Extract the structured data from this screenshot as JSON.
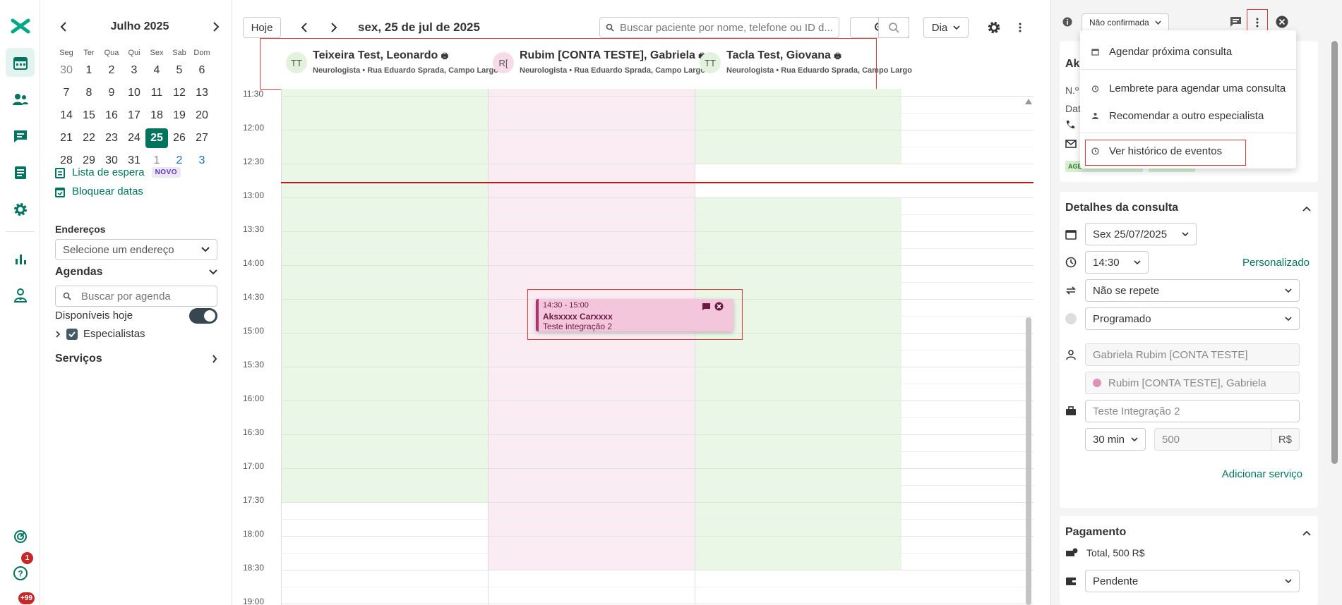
{
  "sidebar": {
    "badges": {
      "help": "1",
      "notifications": "+99"
    }
  },
  "mini_calendar": {
    "month_label": "Julho 2025",
    "weekdays": [
      "Seg",
      "Ter",
      "Qua",
      "Qui",
      "Sex",
      "Sab",
      "Dom"
    ],
    "weeks": [
      [
        "30",
        "1",
        "2",
        "3",
        "4",
        "5",
        "6"
      ],
      [
        "7",
        "8",
        "9",
        "10",
        "11",
        "12",
        "13"
      ],
      [
        "14",
        "15",
        "16",
        "17",
        "18",
        "19",
        "20"
      ],
      [
        "21",
        "22",
        "23",
        "24",
        "25",
        "26",
        "27"
      ],
      [
        "28",
        "29",
        "30",
        "31",
        "1",
        "2",
        "3"
      ]
    ],
    "selected_day": "25"
  },
  "left_panel": {
    "waitlist_label": "Lista de espera",
    "novo_badge": "NOVO",
    "block_dates_label": "Bloquear datas",
    "addresses_label": "Endereços",
    "address_placeholder": "Selecione um endereço",
    "agendas_label": "Agendas",
    "agenda_search_placeholder": "Buscar por agenda",
    "available_today_label": "Disponíveis hoje",
    "specialists_label": "Especialistas",
    "services_label": "Serviços"
  },
  "toolbar": {
    "today_label": "Hoje",
    "date_label": "sex, 25 de jul de 2025",
    "search_placeholder": "Buscar paciente por nome, telefone ou ID d...",
    "view_label": "Dia"
  },
  "resources": [
    {
      "initials": "TT",
      "name": "Teixeira Test, Leonardo",
      "subtitle": "Neurologista • Rua Eduardo Sprada, Campo Largo",
      "avatar_color": "#e3f2dc"
    },
    {
      "initials": "R[",
      "name": "Rubim [CONTA TESTE], Gabriela",
      "subtitle": "Neurologista • Rua Eduardo Sprada, Campo Largo",
      "avatar_color": "#f8dbe8"
    },
    {
      "initials": "TT",
      "name": "Tacla Test, Giovana",
      "subtitle": "Neurologista • Rua Eduardo Sprada, Campo Largo",
      "avatar_color": "#e3f2dc"
    }
  ],
  "time_slots": [
    "11:30",
    "12:00",
    "12:30",
    "13:00",
    "13:30",
    "14:00",
    "14:30",
    "15:00",
    "15:30",
    "16:00",
    "16:30",
    "17:00",
    "17:30",
    "18:00",
    "18:30",
    "19:00"
  ],
  "event": {
    "time": "14:30 - 15:00",
    "patient": "Aksxxxx Carxxxx",
    "service": "Teste integração 2"
  },
  "details": {
    "status_label": "Não confirmada",
    "menu": [
      {
        "icon": "calendar-icon",
        "label": "Agendar próxima consulta"
      },
      {
        "icon": "alarm-icon",
        "label": "Lembrete para agendar uma consulta"
      },
      {
        "icon": "doctor-icon",
        "label": "Recomendar a outro especialista"
      },
      {
        "icon": "history-icon",
        "label": "Ver histórico de eventos"
      }
    ],
    "patient_partial": {
      "name": "Aks",
      "id": "N.º",
      "date": "Dat",
      "tag": "AGE"
    },
    "section_title": "Detalhes da consulta",
    "date_value": "Sex 25/07/2025",
    "time_value": "14:30",
    "custom_label": "Personalizado",
    "repeat_value": "Não se repete",
    "state_value": "Programado",
    "professional_value": "Gabriela Rubim [CONTA TESTE]",
    "agenda_value": "Rubim [CONTA TESTE], Gabriela",
    "service_value": "Teste Integração 2",
    "duration_value": "30 min",
    "price_value": "500",
    "currency": "R$",
    "add_service_label": "Adicionar serviço",
    "payment_title": "Pagamento",
    "payment_total": "Total, 500 R$",
    "payment_status": "Pendente"
  },
  "colors": {
    "brand": "#00745e",
    "available_green": "#eaf6e6",
    "agenda_pink": "#fbecf3",
    "now_line": "#b71c1c",
    "highlight_red": "#e53935"
  }
}
